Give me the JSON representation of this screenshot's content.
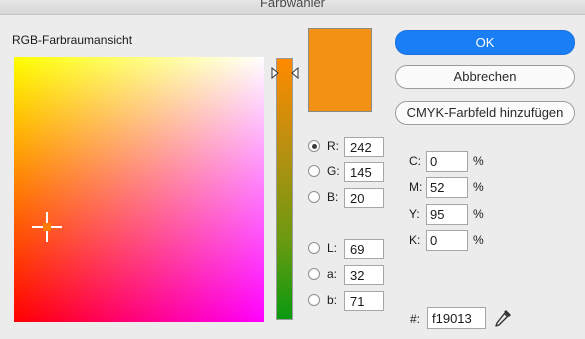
{
  "window": {
    "title": "Farbwähler"
  },
  "picker": {
    "label": "RGB-Farbraumansicht",
    "current_color": "#f29114"
  },
  "fields": {
    "r": {
      "label": "R:",
      "value": "242",
      "selected": true
    },
    "g": {
      "label": "G:",
      "value": "145",
      "selected": false
    },
    "b": {
      "label": "B:",
      "value": "20",
      "selected": false
    },
    "l": {
      "label": "L:",
      "value": "69",
      "selected": false
    },
    "a": {
      "label": "a:",
      "value": "32",
      "selected": false
    },
    "lab_b": {
      "label": "b:",
      "value": "71",
      "selected": false
    }
  },
  "cmyk": {
    "c": {
      "label": "C:",
      "value": "0",
      "unit": "%"
    },
    "m": {
      "label": "M:",
      "value": "52",
      "unit": "%"
    },
    "y": {
      "label": "Y:",
      "value": "95",
      "unit": "%"
    },
    "k": {
      "label": "K:",
      "value": "0",
      "unit": "%"
    }
  },
  "buttons": {
    "ok": "OK",
    "cancel": "Abbrechen",
    "add_swatch": "CMYK-Farbfeld hinzufügen"
  },
  "hex": {
    "label": "#:",
    "value": "f19013"
  },
  "icons": {
    "crosshair": "crosshair-icon",
    "slider_handle": "slider-handle-icon",
    "eyedropper": "eyedropper-icon"
  }
}
